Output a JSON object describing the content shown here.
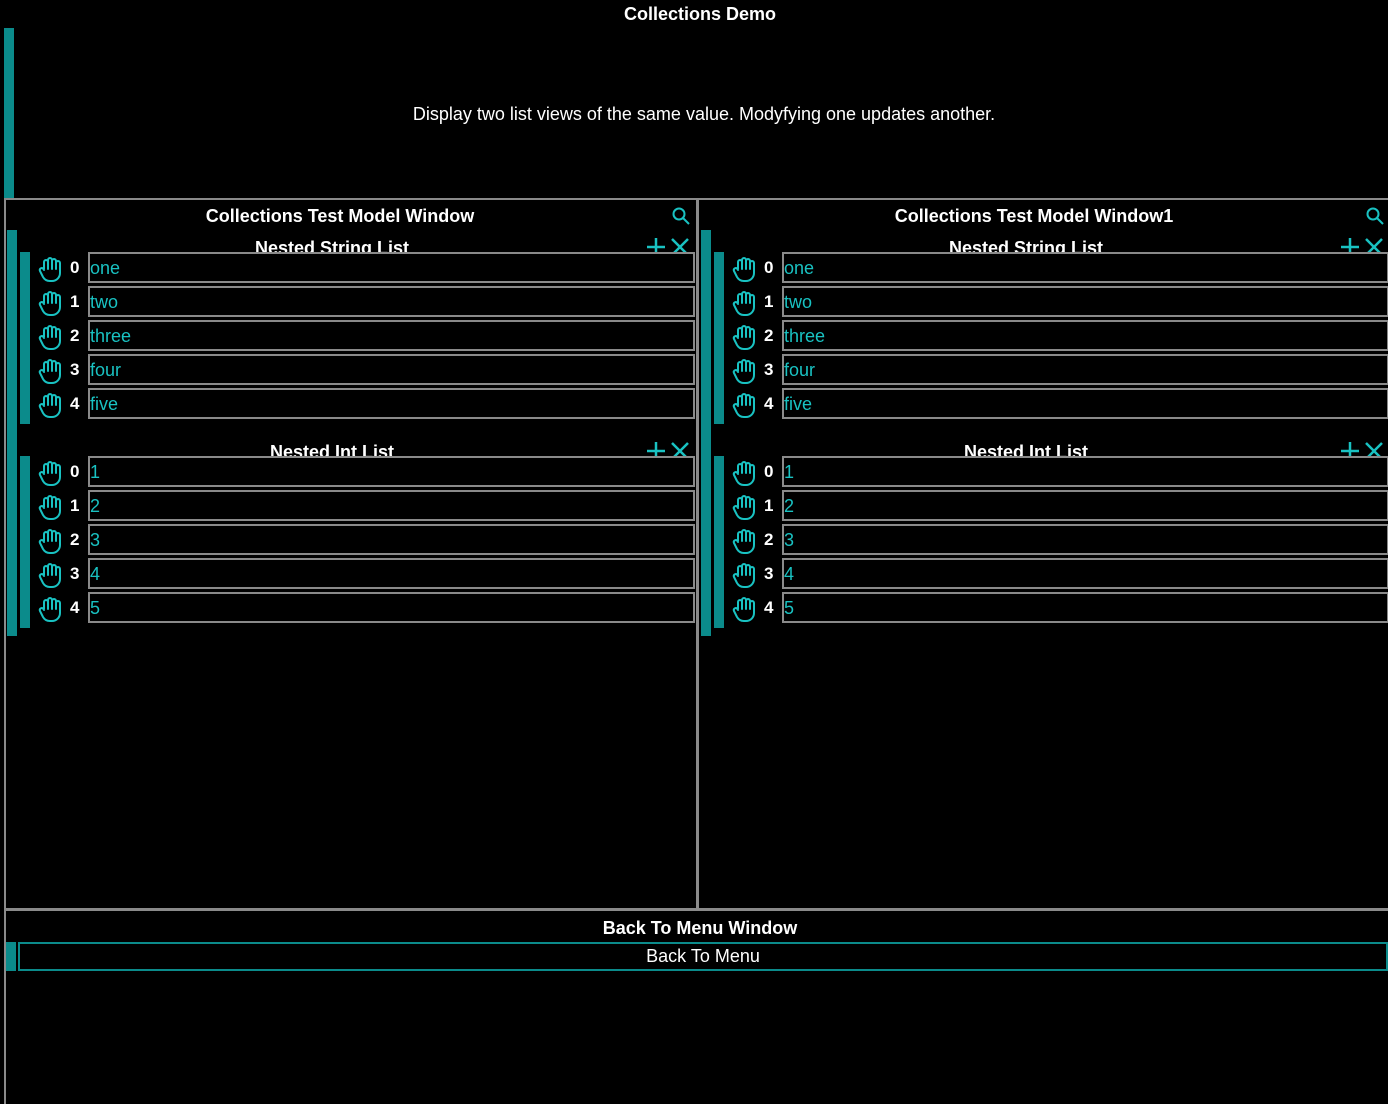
{
  "app": {
    "title": "Collections Demo",
    "description": "Display two list views of the same value. Modyfying one updates another."
  },
  "panels": [
    {
      "title": "Collections Test Model  Window",
      "string_list": {
        "title": "Nested String List",
        "items": [
          {
            "index": "0",
            "value": "one"
          },
          {
            "index": "1",
            "value": "two"
          },
          {
            "index": "2",
            "value": "three"
          },
          {
            "index": "3",
            "value": "four"
          },
          {
            "index": "4",
            "value": "five"
          }
        ]
      },
      "int_list": {
        "title": "Nested Int List",
        "items": [
          {
            "index": "0",
            "value": "1"
          },
          {
            "index": "1",
            "value": "2"
          },
          {
            "index": "2",
            "value": "3"
          },
          {
            "index": "3",
            "value": "4"
          },
          {
            "index": "4",
            "value": "5"
          }
        ]
      }
    },
    {
      "title": "Collections Test Model  Window1",
      "string_list": {
        "title": "Nested String List",
        "items": [
          {
            "index": "0",
            "value": "one"
          },
          {
            "index": "1",
            "value": "two"
          },
          {
            "index": "2",
            "value": "three"
          },
          {
            "index": "3",
            "value": "four"
          },
          {
            "index": "4",
            "value": "five"
          }
        ]
      },
      "int_list": {
        "title": "Nested Int List",
        "items": [
          {
            "index": "0",
            "value": "1"
          },
          {
            "index": "1",
            "value": "2"
          },
          {
            "index": "2",
            "value": "3"
          },
          {
            "index": "3",
            "value": "4"
          },
          {
            "index": "4",
            "value": "5"
          }
        ]
      }
    }
  ],
  "back": {
    "title": "Back To Menu  Window",
    "button_label": "Back To Menu"
  },
  "icons": {
    "search": "search-icon",
    "add": "plus-icon",
    "remove": "close-icon",
    "drag": "hand-drag-icon"
  },
  "colors": {
    "accent": "#0b8b8b",
    "value_text": "#19c2c2",
    "border": "#8a8a8a",
    "background": "#000000"
  }
}
